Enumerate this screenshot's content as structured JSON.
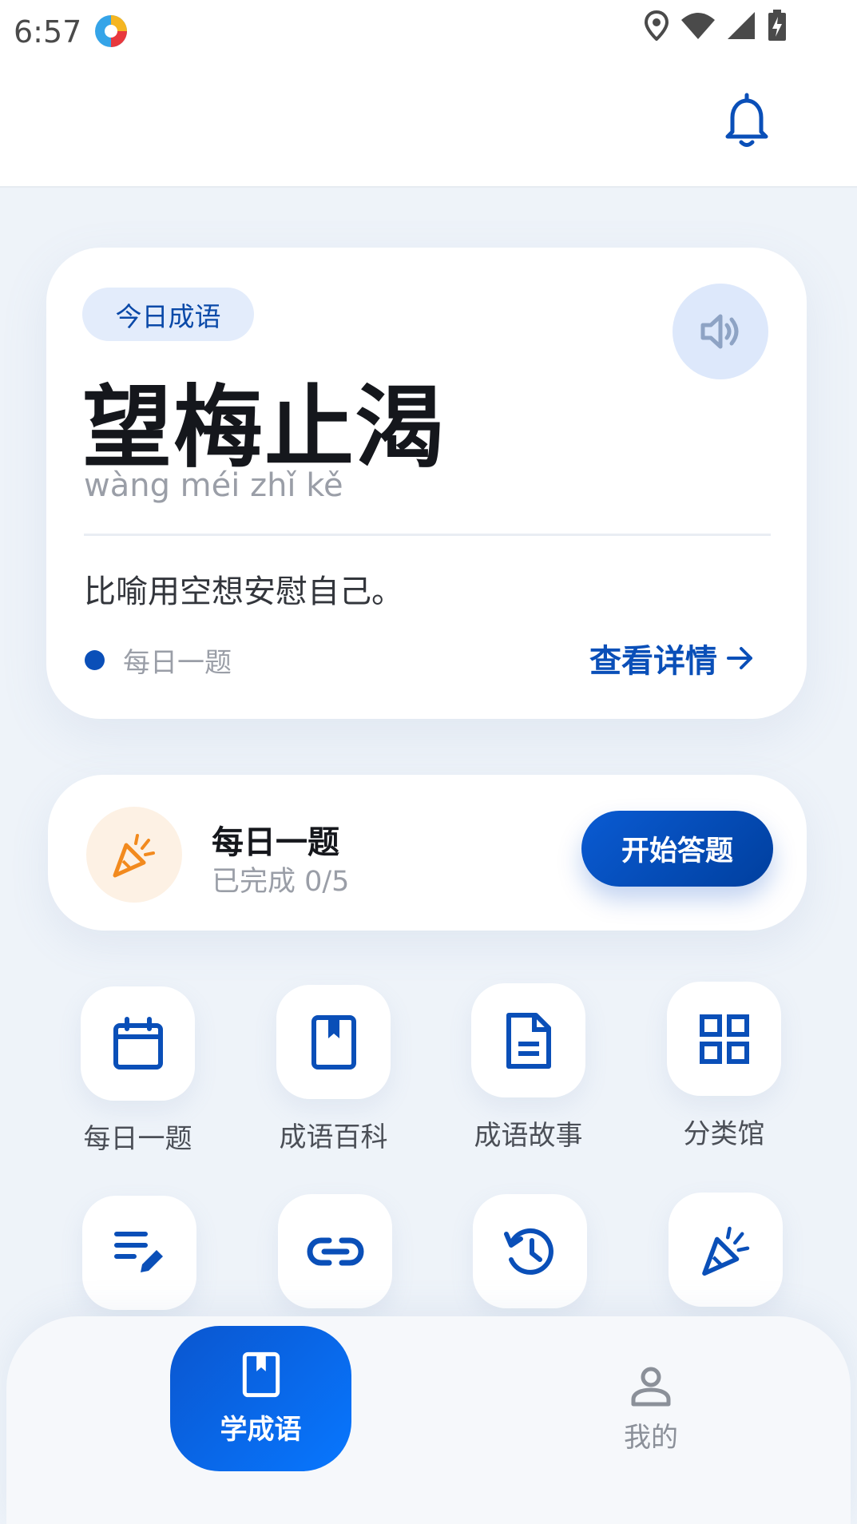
{
  "status_bar": {
    "time": "6:57"
  },
  "today": {
    "tag": "今日成语",
    "idiom": "望梅止渴",
    "pinyin": "wàng méi zhǐ kě",
    "meaning": "比喻用空想安慰自己。",
    "source": "每日一题",
    "detail_link": "查看详情"
  },
  "quiz": {
    "title": "每日一题",
    "progress": "已完成 0/5",
    "button": "开始答题"
  },
  "grid": [
    {
      "label": "每日一题",
      "icon": "calendar-icon"
    },
    {
      "label": "成语百科",
      "icon": "book-icon"
    },
    {
      "label": "成语故事",
      "icon": "document-icon"
    },
    {
      "label": "分类馆",
      "icon": "grid-icon"
    },
    {
      "label": "",
      "icon": "edit-list-icon"
    },
    {
      "label": "",
      "icon": "link-icon"
    },
    {
      "label": "",
      "icon": "history-icon"
    },
    {
      "label": "",
      "icon": "party-popper-icon"
    }
  ],
  "nav": {
    "learn": "学成语",
    "mine": "我的"
  },
  "colors": {
    "accent": "#0a4fb8",
    "accent_light": "#e3ecfb",
    "orange": "#f28a1e"
  }
}
